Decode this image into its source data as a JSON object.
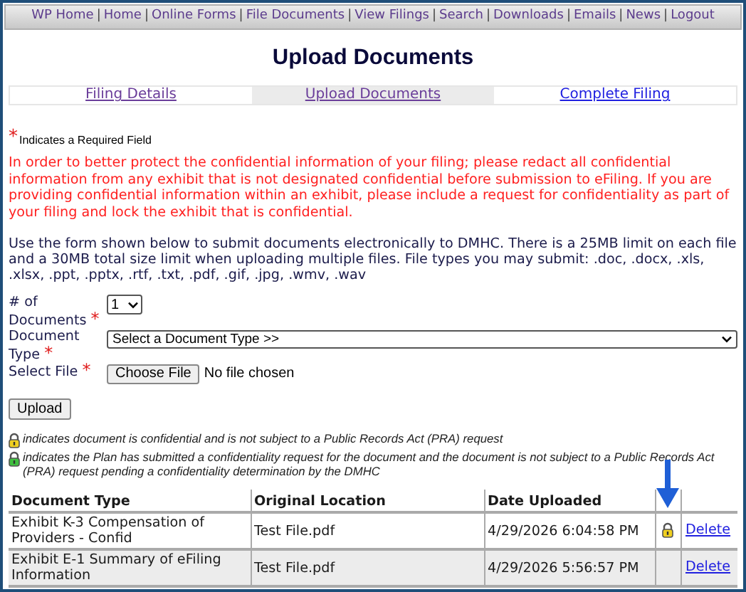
{
  "nav": [
    "WP Home",
    "Home",
    "Online Forms",
    "File Documents",
    "View Filings",
    "Search",
    "Downloads",
    "Emails",
    "News",
    "Logout"
  ],
  "separator": "|",
  "title": "Upload Documents",
  "steps": [
    {
      "label": "Filing Details",
      "selected": false,
      "visited": true
    },
    {
      "label": "Upload Documents",
      "selected": true,
      "visited": true
    },
    {
      "label": "Complete Filing",
      "selected": false,
      "visited": false
    }
  ],
  "required_mark": "*",
  "required_note": "Indicates a Required Field",
  "warning": "In order to better protect the confidential information of your filing; please redact all confidential information from any exhibit that is not designated confidential before submission to eFiling. If you are providing confidential information within an exhibit, please include a request for confidentiality as part of your filing and lock the exhibit that is confidential.",
  "instructions": "Use the form shown below to submit documents electronically to DMHC. There is a 25MB limit on each file and a 30MB total size limit when uploading multiple files. File types you may submit: .doc, .docx, .xls, .xlsx, .ppt, .pptx, .rtf, .txt, .pdf, .gif, .jpg, .wmv, .wav",
  "form": {
    "count_label": "# of Documents",
    "count_value": "1",
    "type_label": "Document Type",
    "type_value": "Select a Document Type >>",
    "file_label": "Select File",
    "file_button": "Choose File",
    "file_status": "No file chosen"
  },
  "upload_button": "Upload",
  "legend": [
    {
      "kind": "confidential",
      "text": "indicates document is confidential and is not subject to a Public Records Act (PRA) request"
    },
    {
      "kind": "pending",
      "text": "indicates the Plan has submitted a confidentiality request for the document and the document is not subject to a Public Records Act (PRA) request pending a confidentiality determination by the DMHC"
    }
  ],
  "table": {
    "columns": [
      "Document Type",
      "Original Location",
      "Date Uploaded"
    ],
    "rows": [
      {
        "document_type": "Exhibit K-3 Compensation of Providers - Confid",
        "location": "Test File.pdf",
        "date": "4/29/2026 6:04:58 PM",
        "locked": true,
        "action": "Delete"
      },
      {
        "document_type": "Exhibit E-1 Summary of eFiling Information",
        "location": "Test File.pdf",
        "date": "4/29/2026 5:56:57 PM",
        "locked": false,
        "action": "Delete"
      }
    ]
  }
}
